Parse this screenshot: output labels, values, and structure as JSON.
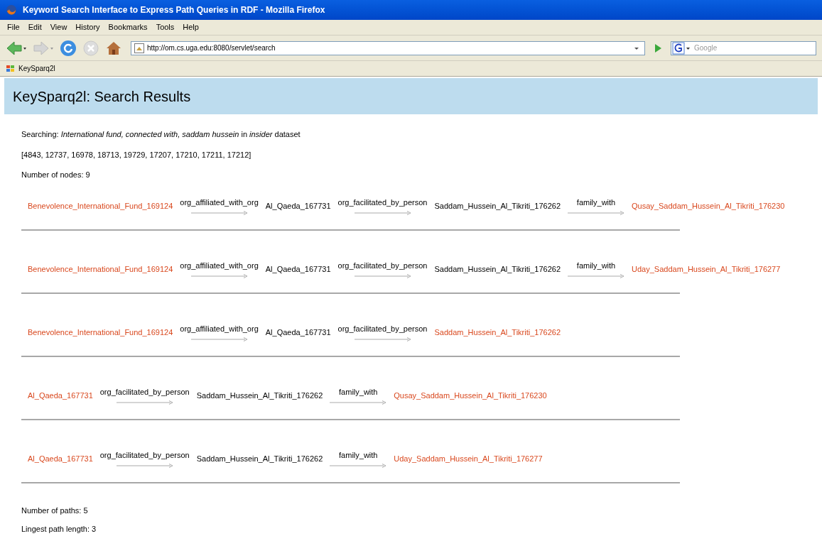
{
  "window": {
    "title": "Keyword Search Interface to Express Path Queries in RDF - Mozilla Firefox"
  },
  "menu": [
    "File",
    "Edit",
    "View",
    "History",
    "Bookmarks",
    "Tools",
    "Help"
  ],
  "address_bar": {
    "value": "http://om.cs.uga.edu:8080/servlet/search"
  },
  "search_field": {
    "placeholder": "Google"
  },
  "bookmarks": [
    "KeySparq2l"
  ],
  "page": {
    "heading": "KeySparq2l: Search Results",
    "searching": "Searching: *International fund, connected with, saddam hussein* in *insider* dataset",
    "ids": "[4843, 12737, 16978, 18713, 19729, 17207, 17210, 17211, 17212]",
    "node_count": "Number of nodes: 9",
    "paths": [
      {
        "steps": [
          {
            "kind": "node",
            "label": "Benevolence_International_Fund_169124",
            "matched": true
          },
          {
            "kind": "edge",
            "label": "org_affiliated_with_org"
          },
          {
            "kind": "node",
            "label": "Al_Qaeda_167731",
            "matched": false
          },
          {
            "kind": "edge",
            "label": "org_facilitated_by_person"
          },
          {
            "kind": "node",
            "label": "Saddam_Hussein_Al_Tikriti_176262",
            "matched": false
          },
          {
            "kind": "edge",
            "label": "family_with"
          },
          {
            "kind": "node",
            "label": "Qusay_Saddam_Hussein_Al_Tikriti_176230",
            "matched": true
          }
        ]
      },
      {
        "steps": [
          {
            "kind": "node",
            "label": "Benevolence_International_Fund_169124",
            "matched": true
          },
          {
            "kind": "edge",
            "label": "org_affiliated_with_org"
          },
          {
            "kind": "node",
            "label": "Al_Qaeda_167731",
            "matched": false
          },
          {
            "kind": "edge",
            "label": "org_facilitated_by_person"
          },
          {
            "kind": "node",
            "label": "Saddam_Hussein_Al_Tikriti_176262",
            "matched": false
          },
          {
            "kind": "edge",
            "label": "family_with"
          },
          {
            "kind": "node",
            "label": "Uday_Saddam_Hussein_Al_Tikriti_176277",
            "matched": true
          }
        ]
      },
      {
        "steps": [
          {
            "kind": "node",
            "label": "Benevolence_International_Fund_169124",
            "matched": true
          },
          {
            "kind": "edge",
            "label": "org_affiliated_with_org"
          },
          {
            "kind": "node",
            "label": "Al_Qaeda_167731",
            "matched": false
          },
          {
            "kind": "edge",
            "label": "org_facilitated_by_person"
          },
          {
            "kind": "node",
            "label": "Saddam_Hussein_Al_Tikriti_176262",
            "matched": true
          }
        ]
      },
      {
        "steps": [
          {
            "kind": "node",
            "label": "Al_Qaeda_167731",
            "matched": true
          },
          {
            "kind": "edge",
            "label": "org_facilitated_by_person"
          },
          {
            "kind": "node",
            "label": "Saddam_Hussein_Al_Tikriti_176262",
            "matched": false
          },
          {
            "kind": "edge",
            "label": "family_with"
          },
          {
            "kind": "node",
            "label": "Qusay_Saddam_Hussein_Al_Tikriti_176230",
            "matched": true
          }
        ]
      },
      {
        "steps": [
          {
            "kind": "node",
            "label": "Al_Qaeda_167731",
            "matched": true
          },
          {
            "kind": "edge",
            "label": "org_facilitated_by_person"
          },
          {
            "kind": "node",
            "label": "Saddam_Hussein_Al_Tikriti_176262",
            "matched": false
          },
          {
            "kind": "edge",
            "label": "family_with"
          },
          {
            "kind": "node",
            "label": "Uday_Saddam_Hussein_Al_Tikriti_176277",
            "matched": true
          }
        ]
      }
    ],
    "path_count": "Number of paths: 5",
    "longest": "Lingest path length: 3"
  }
}
